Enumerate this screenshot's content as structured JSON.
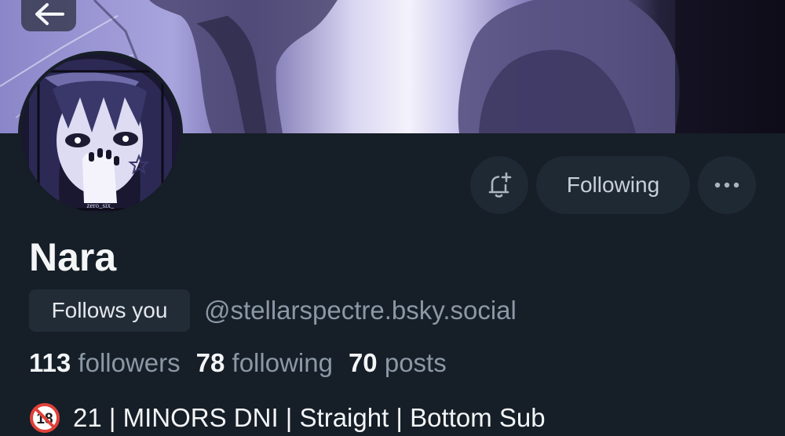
{
  "header": {
    "back_icon": "arrow-left-icon"
  },
  "avatar": {
    "watermark": "zero_six_"
  },
  "actions": {
    "subscribe_icon": "bell-plus-icon",
    "following_label": "Following",
    "more_icon": "ellipsis-icon"
  },
  "profile": {
    "display_name": "Nara",
    "follows_you_label": "Follows you",
    "handle": "@stellarspectre.bsky.social"
  },
  "stats": {
    "followers_count": "113",
    "followers_label": "followers",
    "following_count": "78",
    "following_label": "following",
    "posts_count": "70",
    "posts_label": "posts"
  },
  "bio": {
    "icon": "no-under-18-icon",
    "text": "21 | MINORS DNI | Straight | Bottom Sub"
  },
  "colors": {
    "background": "#161e27",
    "button_bg": "#1f2934",
    "muted_text": "#8b98a6",
    "primary_text": "#f3f5f7"
  }
}
